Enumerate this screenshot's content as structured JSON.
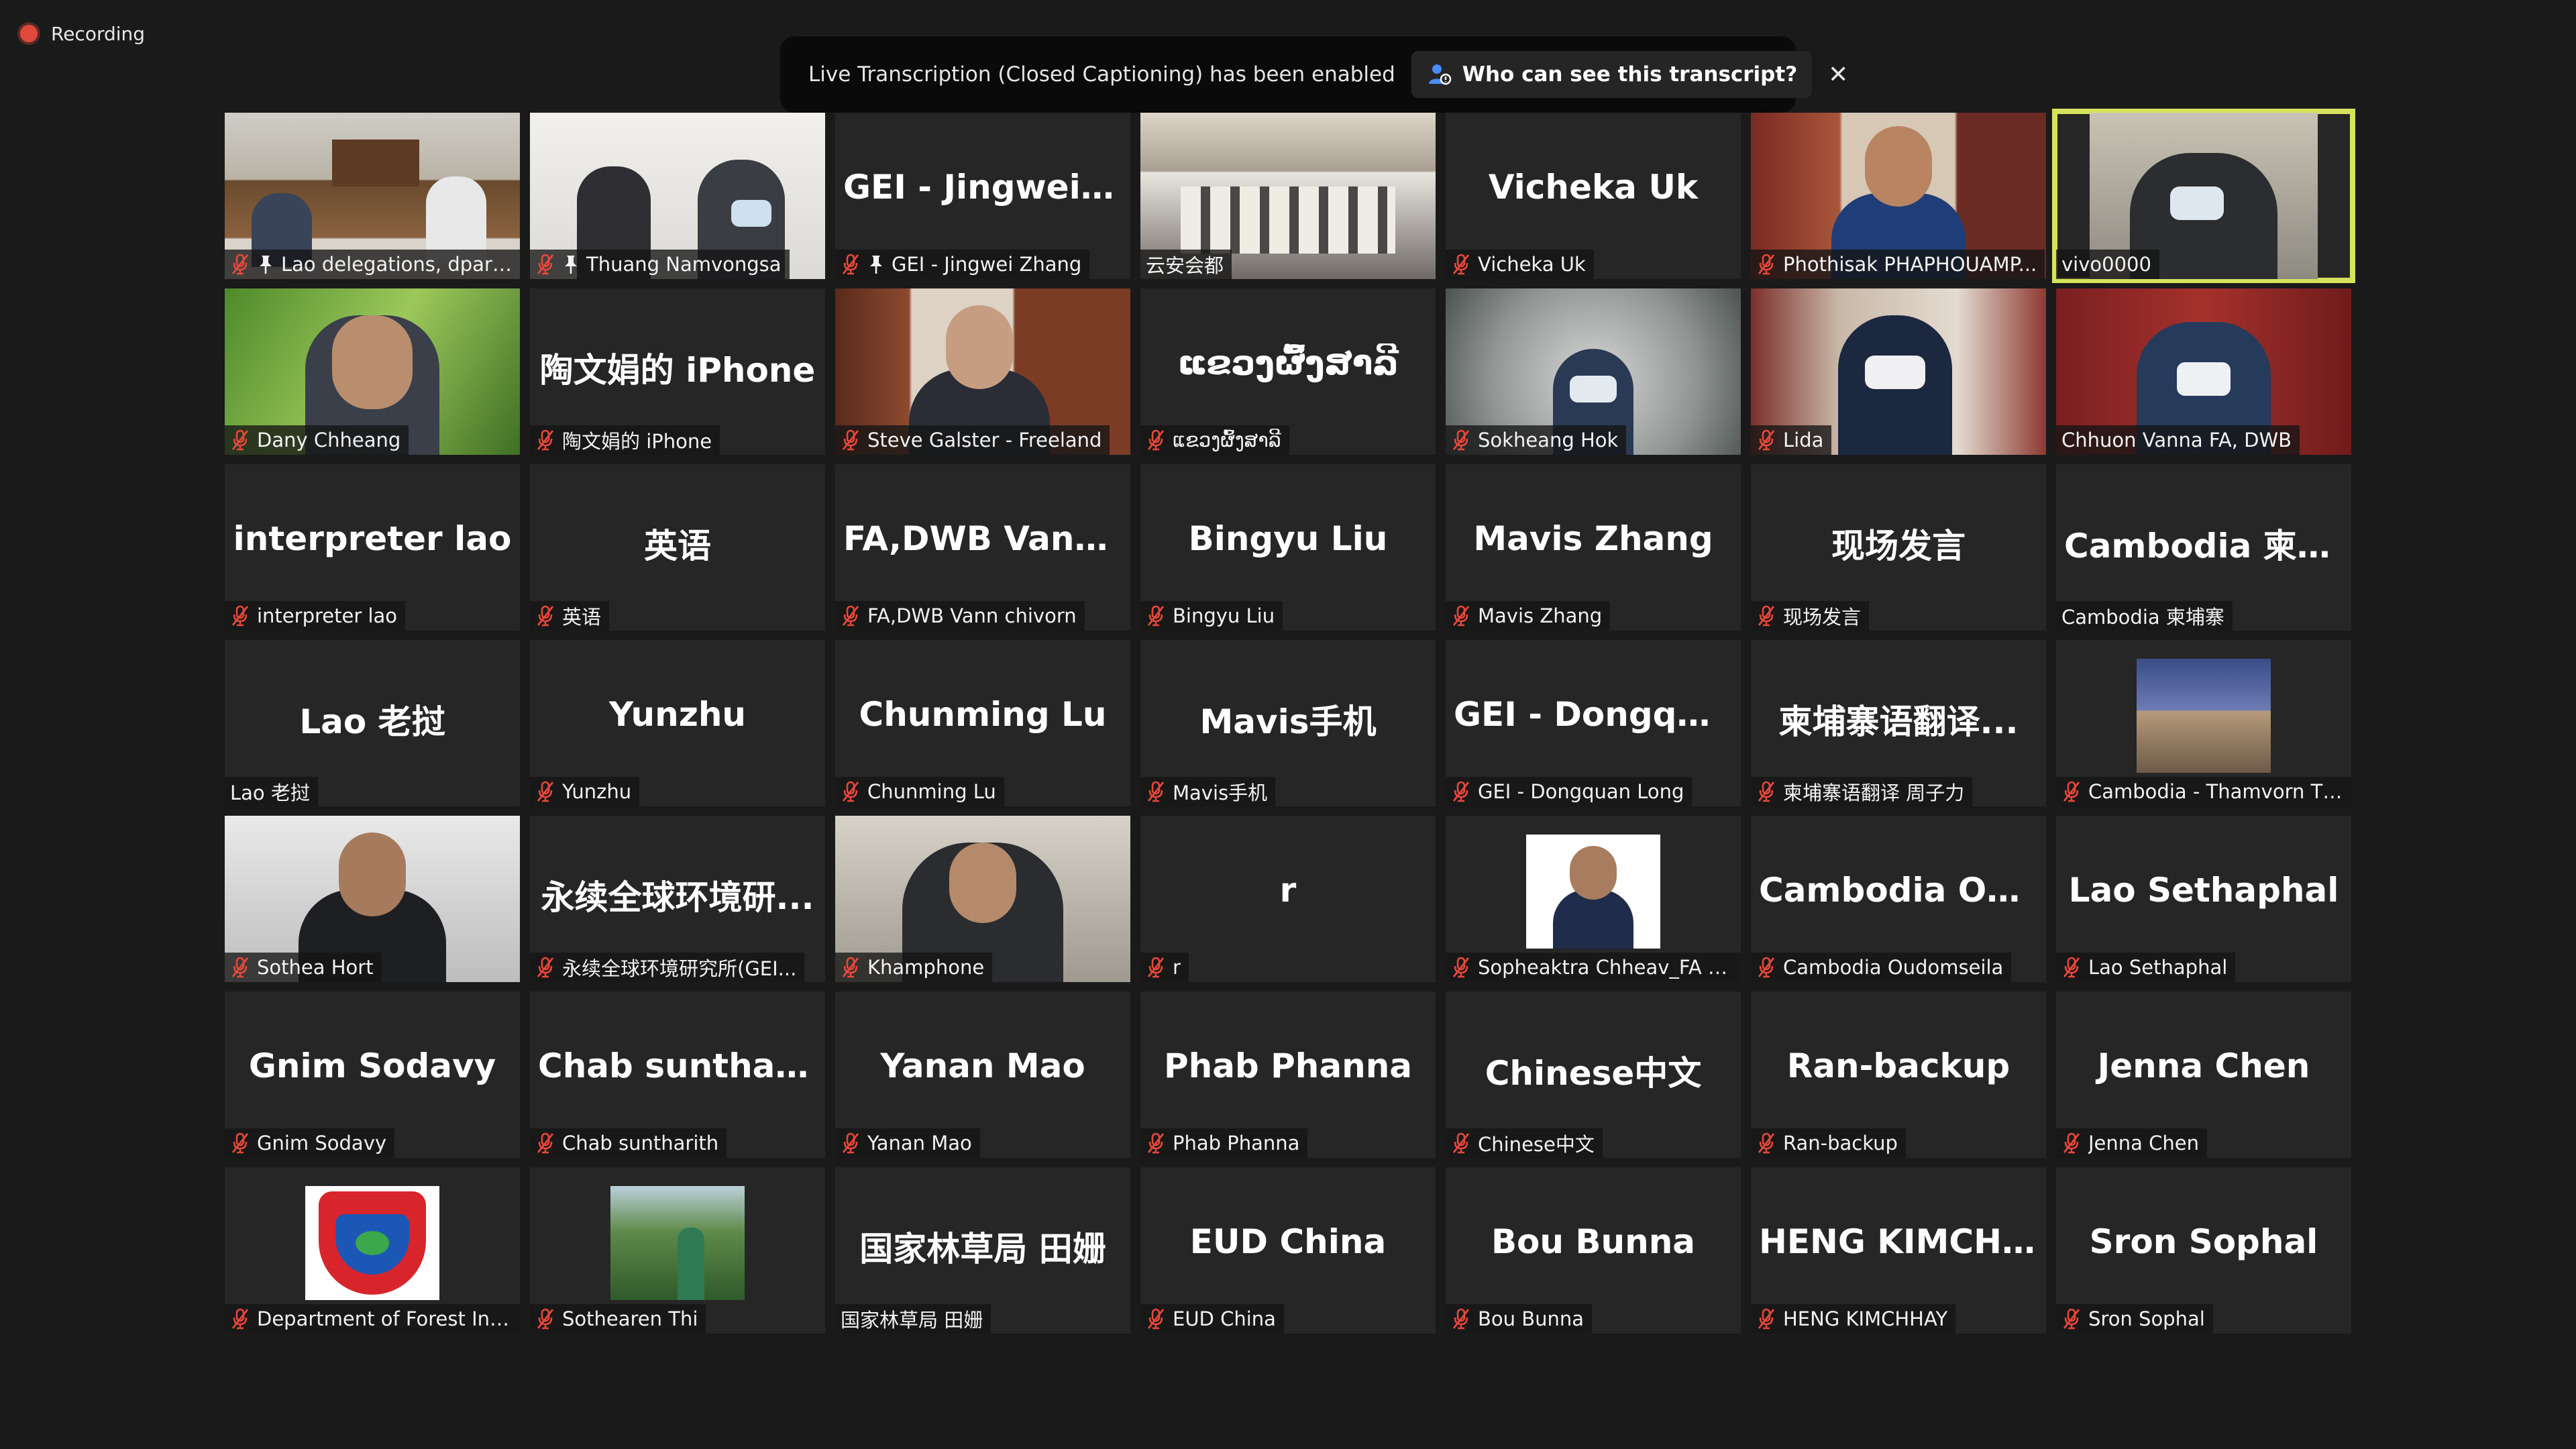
{
  "recording": {
    "label": "Recording"
  },
  "banner": {
    "text": "Live Transcription (Closed Captioning) has been enabled",
    "who_label": "Who can see this transcript?",
    "close_symbol": "✕"
  },
  "colors": {
    "background": "#1a1a1a",
    "tile": "#262626",
    "active_border": "#d5e35c",
    "mic_muted": "#e8473a"
  },
  "participants": [
    {
      "name": "Lao delegations, dpart...",
      "big": "",
      "muted": true,
      "pinned": true,
      "video": "room-table"
    },
    {
      "name": "Thuang Namvongsa",
      "big": "",
      "muted": true,
      "pinned": true,
      "video": "two-people-masks"
    },
    {
      "name": "GEI - Jingwei Zhang",
      "big": "GEI - Jingwei Zh...",
      "muted": true,
      "pinned": true,
      "video": ""
    },
    {
      "name": "云安会都",
      "big": "",
      "muted": false,
      "pinned": false,
      "video": "conference-hall"
    },
    {
      "name": "Vicheka Uk",
      "big": "Vicheka Uk",
      "muted": true,
      "pinned": false,
      "video": ""
    },
    {
      "name": "Phothisak PHAPHOUAMP...",
      "big": "",
      "muted": true,
      "pinned": false,
      "video": "uniform-bookshelf"
    },
    {
      "name": "vivo0000",
      "big": "",
      "muted": false,
      "pinned": false,
      "video": "person-mask-phone",
      "active": true
    },
    {
      "name": "Dany Chheang",
      "big": "",
      "muted": true,
      "pinned": false,
      "video": "man-green-bg"
    },
    {
      "name": "陶文娟的 iPhone",
      "big": "陶文娟的 iPhone",
      "muted": true,
      "pinned": false,
      "video": ""
    },
    {
      "name": "Steve Galster - Freeland",
      "big": "",
      "muted": true,
      "pinned": false,
      "video": "man-bookshelf"
    },
    {
      "name": "ແຂວງຜົ້ງສາລີ",
      "big": "ແຂວງຜົ້ງສາລີ",
      "muted": true,
      "pinned": false,
      "video": ""
    },
    {
      "name": "Sokheang Hok",
      "big": "",
      "muted": true,
      "pinned": false,
      "video": "man-mask-blur"
    },
    {
      "name": "Lida",
      "big": "",
      "muted": true,
      "pinned": false,
      "video": "woman-mask-bookshelf"
    },
    {
      "name": "Chhuon Vanna FA, DWB",
      "big": "",
      "muted": false,
      "pinned": false,
      "video": "man-mask-red"
    },
    {
      "name": "interpreter lao",
      "big": "interpreter lao",
      "muted": true,
      "pinned": false,
      "video": ""
    },
    {
      "name": "英语",
      "big": "英语",
      "muted": true,
      "pinned": false,
      "video": ""
    },
    {
      "name": "FA,DWB Vann chivorn",
      "big": "FA,DWB Vann c...",
      "muted": true,
      "pinned": false,
      "video": ""
    },
    {
      "name": "Bingyu Liu",
      "big": "Bingyu Liu",
      "muted": true,
      "pinned": false,
      "video": ""
    },
    {
      "name": "Mavis Zhang",
      "big": "Mavis Zhang",
      "muted": true,
      "pinned": false,
      "video": ""
    },
    {
      "name": "现场发言",
      "big": "现场发言",
      "muted": true,
      "pinned": false,
      "video": ""
    },
    {
      "name": "Cambodia 柬埔寨",
      "big": "Cambodia 柬埔寨",
      "muted": false,
      "pinned": false,
      "video": ""
    },
    {
      "name": "Lao 老挝",
      "big": "Lao 老挝",
      "muted": false,
      "pinned": false,
      "video": ""
    },
    {
      "name": "Yunzhu",
      "big": "Yunzhu",
      "muted": true,
      "pinned": false,
      "video": ""
    },
    {
      "name": "Chunming Lu",
      "big": "Chunming Lu",
      "muted": true,
      "pinned": false,
      "video": ""
    },
    {
      "name": "Mavis手机",
      "big": "Mavis手机",
      "muted": true,
      "pinned": false,
      "video": ""
    },
    {
      "name": "GEI - Dongquan Long",
      "big": "GEI - Dongquan...",
      "muted": true,
      "pinned": false,
      "video": ""
    },
    {
      "name": "柬埔寨语翻译 周子力",
      "big": "柬埔寨语翻译...",
      "muted": true,
      "pinned": false,
      "video": ""
    },
    {
      "name": "Cambodia - Thamvorn Th...",
      "big": "",
      "muted": true,
      "pinned": false,
      "video": "building-thumb"
    },
    {
      "name": "Sothea Hort",
      "big": "",
      "muted": true,
      "pinned": false,
      "video": "man-uniform"
    },
    {
      "name": "永续全球环境研究所(GEI...",
      "big": "永续全球环境研...",
      "muted": true,
      "pinned": false,
      "video": ""
    },
    {
      "name": "Khamphone",
      "big": "",
      "muted": true,
      "pinned": false,
      "video": "man-close"
    },
    {
      "name": "r",
      "big": "r",
      "muted": true,
      "pinned": false,
      "video": ""
    },
    {
      "name": "Sopheaktra Chheav_FA (C...",
      "big": "",
      "muted": true,
      "pinned": false,
      "video": "portrait-thumb"
    },
    {
      "name": "Cambodia Oudomseila",
      "big": "Cambodia Oud...",
      "muted": true,
      "pinned": false,
      "video": ""
    },
    {
      "name": "Lao Sethaphal",
      "big": "Lao Sethaphal",
      "muted": true,
      "pinned": false,
      "video": ""
    },
    {
      "name": "Gnim Sodavy",
      "big": "Gnim Sodavy",
      "muted": true,
      "pinned": false,
      "video": ""
    },
    {
      "name": "Chab suntharith",
      "big": "Chab suntharith",
      "muted": true,
      "pinned": false,
      "video": ""
    },
    {
      "name": "Yanan Mao",
      "big": "Yanan Mao",
      "muted": true,
      "pinned": false,
      "video": ""
    },
    {
      "name": "Phab Phanna",
      "big": "Phab Phanna",
      "muted": true,
      "pinned": false,
      "video": ""
    },
    {
      "name": "Chinese中文",
      "big": "Chinese中文",
      "muted": true,
      "pinned": false,
      "video": ""
    },
    {
      "name": "Ran-backup",
      "big": "Ran-backup",
      "muted": true,
      "pinned": false,
      "video": ""
    },
    {
      "name": "Jenna Chen",
      "big": "Jenna Chen",
      "muted": true,
      "pinned": false,
      "video": ""
    },
    {
      "name": "Department of Forest Ins...",
      "big": "",
      "muted": true,
      "pinned": false,
      "video": "badge-thumb"
    },
    {
      "name": "Sothearen Thi",
      "big": "",
      "muted": true,
      "pinned": false,
      "video": "forest-thumb"
    },
    {
      "name": "国家林草局 田姗",
      "big": "国家林草局 田姗",
      "muted": false,
      "pinned": false,
      "video": ""
    },
    {
      "name": "EUD China",
      "big": "EUD China",
      "muted": true,
      "pinned": false,
      "video": ""
    },
    {
      "name": "Bou Bunna",
      "big": "Bou Bunna",
      "muted": true,
      "pinned": false,
      "video": ""
    },
    {
      "name": "HENG KIMCHHAY",
      "big": "HENG KIMCHHAY",
      "muted": true,
      "pinned": false,
      "video": ""
    },
    {
      "name": "Sron Sophal",
      "big": "Sron Sophal",
      "muted": true,
      "pinned": false,
      "video": ""
    }
  ]
}
